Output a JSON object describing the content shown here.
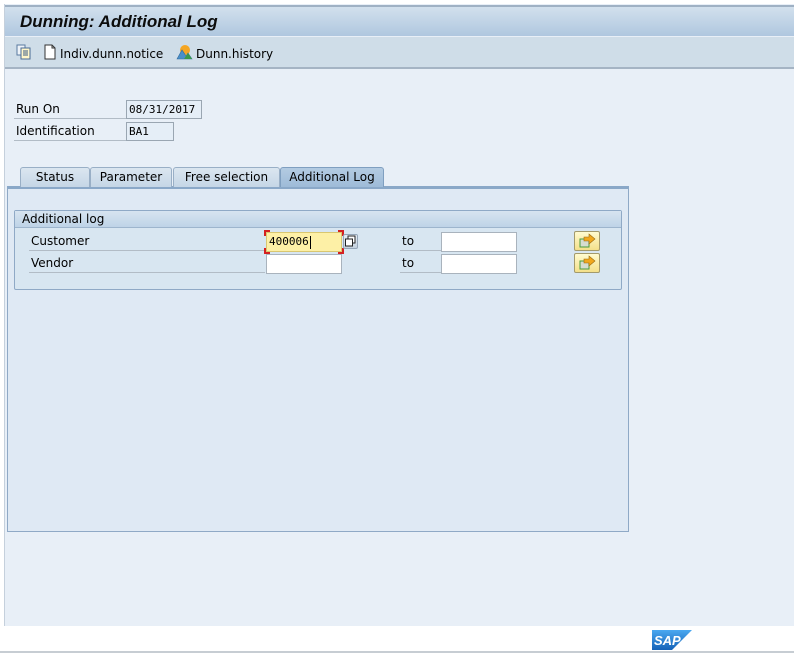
{
  "window": {
    "title": "Dunning: Additional Log"
  },
  "toolbar": {
    "items": [
      {
        "icon": "copy-doc-icon",
        "label": ""
      },
      {
        "icon": "document-icon",
        "label": "Indiv.dunn.notice"
      },
      {
        "icon": "mountain-history-icon",
        "label": "Dunn.history"
      }
    ]
  },
  "header_fields": {
    "run_on": {
      "label": "Run On",
      "value": "08/31/2017"
    },
    "identification": {
      "label": "Identification",
      "value": "BA1"
    }
  },
  "tabs": [
    {
      "label": "Status",
      "active": false
    },
    {
      "label": "Parameter",
      "active": false
    },
    {
      "label": "Free selection",
      "active": false
    },
    {
      "label": "Additional Log",
      "active": true
    }
  ],
  "group": {
    "title": "Additional log",
    "rows": [
      {
        "label": "Customer",
        "from": "400006",
        "to_label": "to",
        "to": "",
        "focused": true
      },
      {
        "label": "Vendor",
        "from": "",
        "to_label": "to",
        "to": "",
        "focused": false
      }
    ]
  },
  "footer": {
    "logo": "SAP"
  },
  "colors": {
    "focused_input_bg": "#fdf0a6",
    "focus_corner": "#d42020",
    "active_tab": "#9ebbd8",
    "sap_blue": "#1a73c6"
  }
}
